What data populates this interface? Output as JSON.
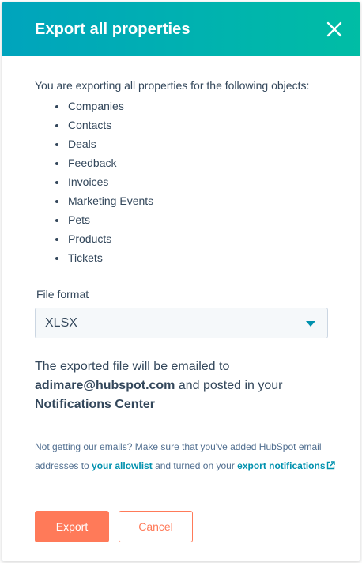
{
  "dialog": {
    "title": "Export all properties",
    "close_icon": "close-icon"
  },
  "intro": "You are exporting all properties for the following objects:",
  "objects": [
    "Companies",
    "Contacts",
    "Deals",
    "Feedback",
    "Invoices",
    "Marketing Events",
    "Pets",
    "Products",
    "Tickets"
  ],
  "file_format": {
    "label": "File format",
    "selected": "XLSX",
    "caret_icon": "caret-down-icon"
  },
  "notice": {
    "text_1": "The exported file will be emailed to",
    "email": "adimare@hubspot.com",
    "text_2": " and posted in your",
    "center": "Notifications Center"
  },
  "help": {
    "text_1": "Not getting our emails? Make sure that you've added HubSpot email addresses to ",
    "allowlist_link": "your allowlist",
    "text_2": " and turned on your ",
    "notifications_link": "export notifications",
    "external_icon": "external-link-icon"
  },
  "buttons": {
    "export": "Export",
    "cancel": "Cancel"
  },
  "colors": {
    "header_start": "#00a4bd",
    "header_end": "#00bda5",
    "primary": "#ff7a59",
    "link": "#0091ae",
    "text": "#33475b"
  }
}
